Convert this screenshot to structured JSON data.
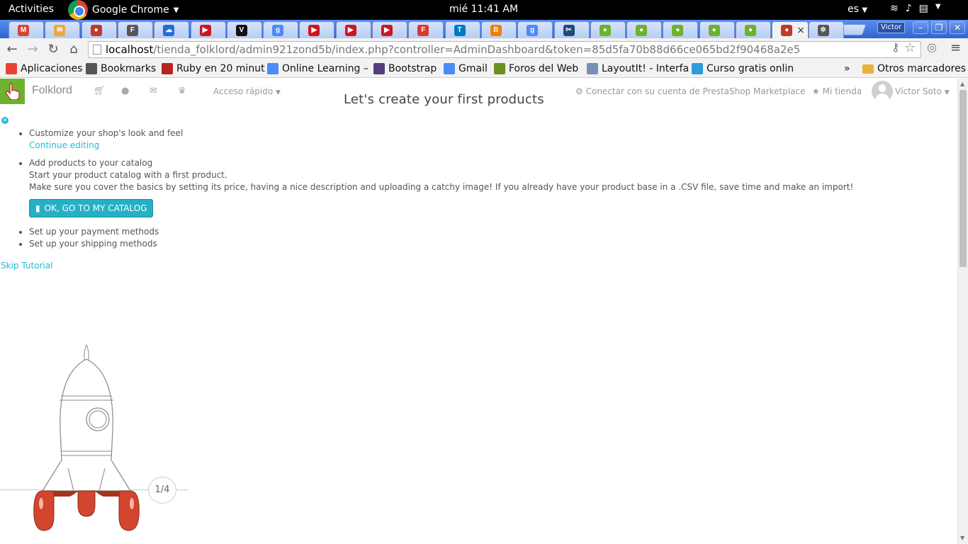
{
  "topbar": {
    "activities": "Activities",
    "app_name": "Google Chrome",
    "clock": "mié 11:41 AM",
    "lang": "es"
  },
  "tabs": [
    {
      "icon": "gmail-icon",
      "color": "#d44638",
      "glyph": "M"
    },
    {
      "icon": "mail-icon",
      "color": "#e8a93a",
      "glyph": "✉"
    },
    {
      "icon": "prestashop-icon",
      "color": "#c0392b",
      "glyph": "●"
    },
    {
      "icon": "f-script-icon",
      "color": "#555555",
      "glyph": "F"
    },
    {
      "icon": "onedrive-icon",
      "color": "#1e6fd9",
      "glyph": "☁"
    },
    {
      "icon": "youtube-icon",
      "color": "#cc181e",
      "glyph": "▶"
    },
    {
      "icon": "v-icon",
      "color": "#111111",
      "glyph": "V"
    },
    {
      "icon": "google-icon",
      "color": "#4c8bf5",
      "glyph": "g"
    },
    {
      "icon": "youtube-icon",
      "color": "#cc181e",
      "glyph": "▶"
    },
    {
      "icon": "youtube-icon",
      "color": "#cc181e",
      "glyph": "▶"
    },
    {
      "icon": "youtube-icon",
      "color": "#cc181e",
      "glyph": "▶"
    },
    {
      "icon": "flash-icon",
      "color": "#d63a2f",
      "glyph": "F"
    },
    {
      "icon": "trello-icon",
      "color": "#0079bf",
      "glyph": "T"
    },
    {
      "icon": "blogger-icon",
      "color": "#f57d00",
      "glyph": "B"
    },
    {
      "icon": "google-icon",
      "color": "#4c8bf5",
      "glyph": "g"
    },
    {
      "icon": "tools-icon",
      "color": "#1e4b7a",
      "glyph": "✂"
    },
    {
      "icon": "android-icon",
      "color": "#6cb22d",
      "glyph": "●"
    },
    {
      "icon": "android-icon",
      "color": "#6cb22d",
      "glyph": "●"
    },
    {
      "icon": "android-icon",
      "color": "#6cb22d",
      "glyph": "●"
    },
    {
      "icon": "android-icon",
      "color": "#6cb22d",
      "glyph": "●"
    },
    {
      "icon": "android-icon",
      "color": "#6cb22d",
      "glyph": "●"
    },
    {
      "icon": "prestashop-icon",
      "color": "#c0392b",
      "glyph": "●"
    },
    {
      "icon": "settings-icon",
      "color": "#555555",
      "glyph": "✲"
    }
  ],
  "profile_name": "Victor",
  "omnibox": {
    "host": "localhost",
    "path": "/tienda_folklord/admin921zond5b/index.php?controller=AdminDashboard&token=85d5fa70b88d66ce065bd2f90468a2e5"
  },
  "bookmarks": [
    {
      "label": "Aplicaciones",
      "icon": "apps-icon",
      "color": "#e94235"
    },
    {
      "label": "Bookmarks",
      "icon": "star-icon",
      "color": "#555555"
    },
    {
      "label": "Ruby en 20 minut",
      "icon": "ruby-icon",
      "color": "#b3261e"
    },
    {
      "label": "Online Learning –",
      "icon": "google-icon",
      "color": "#4c8bf5"
    },
    {
      "label": "Bootstrap",
      "icon": "bootstrap-icon",
      "color": "#563d7c"
    },
    {
      "label": "Gmail",
      "icon": "google-icon",
      "color": "#4c8bf5"
    },
    {
      "label": "Foros del Web",
      "icon": "foros-icon",
      "color": "#6b8e23"
    },
    {
      "label": "LayoutIt! - Interfa",
      "icon": "grid-icon",
      "color": "#7a8fb3"
    },
    {
      "label": "Curso gratis onlin",
      "icon": "bulb-icon",
      "color": "#2d9cdb"
    }
  ],
  "bookmarks_overflow": "»",
  "other_bookmarks": "Otros marcadores",
  "ps": {
    "brand": "Folklord",
    "quick_access": "Acceso rápido",
    "title": "Let's create your first products",
    "marketplace": "Conectar con su cuenta de PrestaShop Marketplace",
    "my_shop": "Mi tienda",
    "user": "Víctor Soto"
  },
  "tutorial": {
    "step1_title": "Customize your shop's look and feel",
    "step1_link": "Continue editing",
    "step2_title": "Add products to your catalog",
    "step2_line1": "Start your product catalog with a first product.",
    "step2_line2": "Make sure you cover the basics by setting its price, having a nice description and uploading a catchy image! If you already have your product base in a .CSV file, save time and make an import!",
    "cta_label": "OK, GO TO MY CATALOG",
    "step3_title": "Set up your payment methods",
    "step4_title": "Set up your shipping methods",
    "skip": "Skip Tutorial",
    "counter": "1/4"
  },
  "colors": {
    "accent": "#25b9d7",
    "ps_green": "#6cb22d",
    "rocket_red": "#d2452e"
  }
}
